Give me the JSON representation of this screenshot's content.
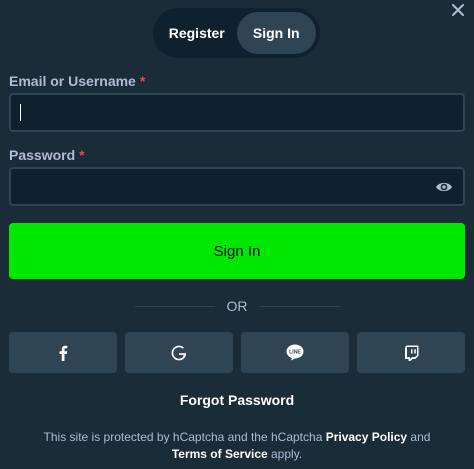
{
  "tabs": {
    "register_label": "Register",
    "signin_label": "Sign In"
  },
  "form": {
    "email_label": "Email or Username",
    "email_required": "*",
    "email_value": "",
    "password_label": "Password",
    "password_required": "*",
    "password_value": "",
    "submit_label": "Sign In"
  },
  "divider": {
    "text": "OR"
  },
  "social": [
    {
      "name": "facebook-icon"
    },
    {
      "name": "google-icon"
    },
    {
      "name": "line-icon"
    },
    {
      "name": "twitch-icon"
    }
  ],
  "forgot_label": "Forgot Password",
  "notice": {
    "text_before": "This site is protected by hCaptcha and the hCaptcha ",
    "privacy_label": "Privacy Policy",
    "text_and": " and",
    "terms_label": "Terms of Service",
    "text_after": " apply."
  },
  "colors": {
    "background": "#1a2c38",
    "input_bg": "#0f212e",
    "accent_green": "#00e701",
    "button_gray": "#2f4553"
  },
  "icons": {
    "close": "close-icon",
    "eye": "eye-icon"
  }
}
